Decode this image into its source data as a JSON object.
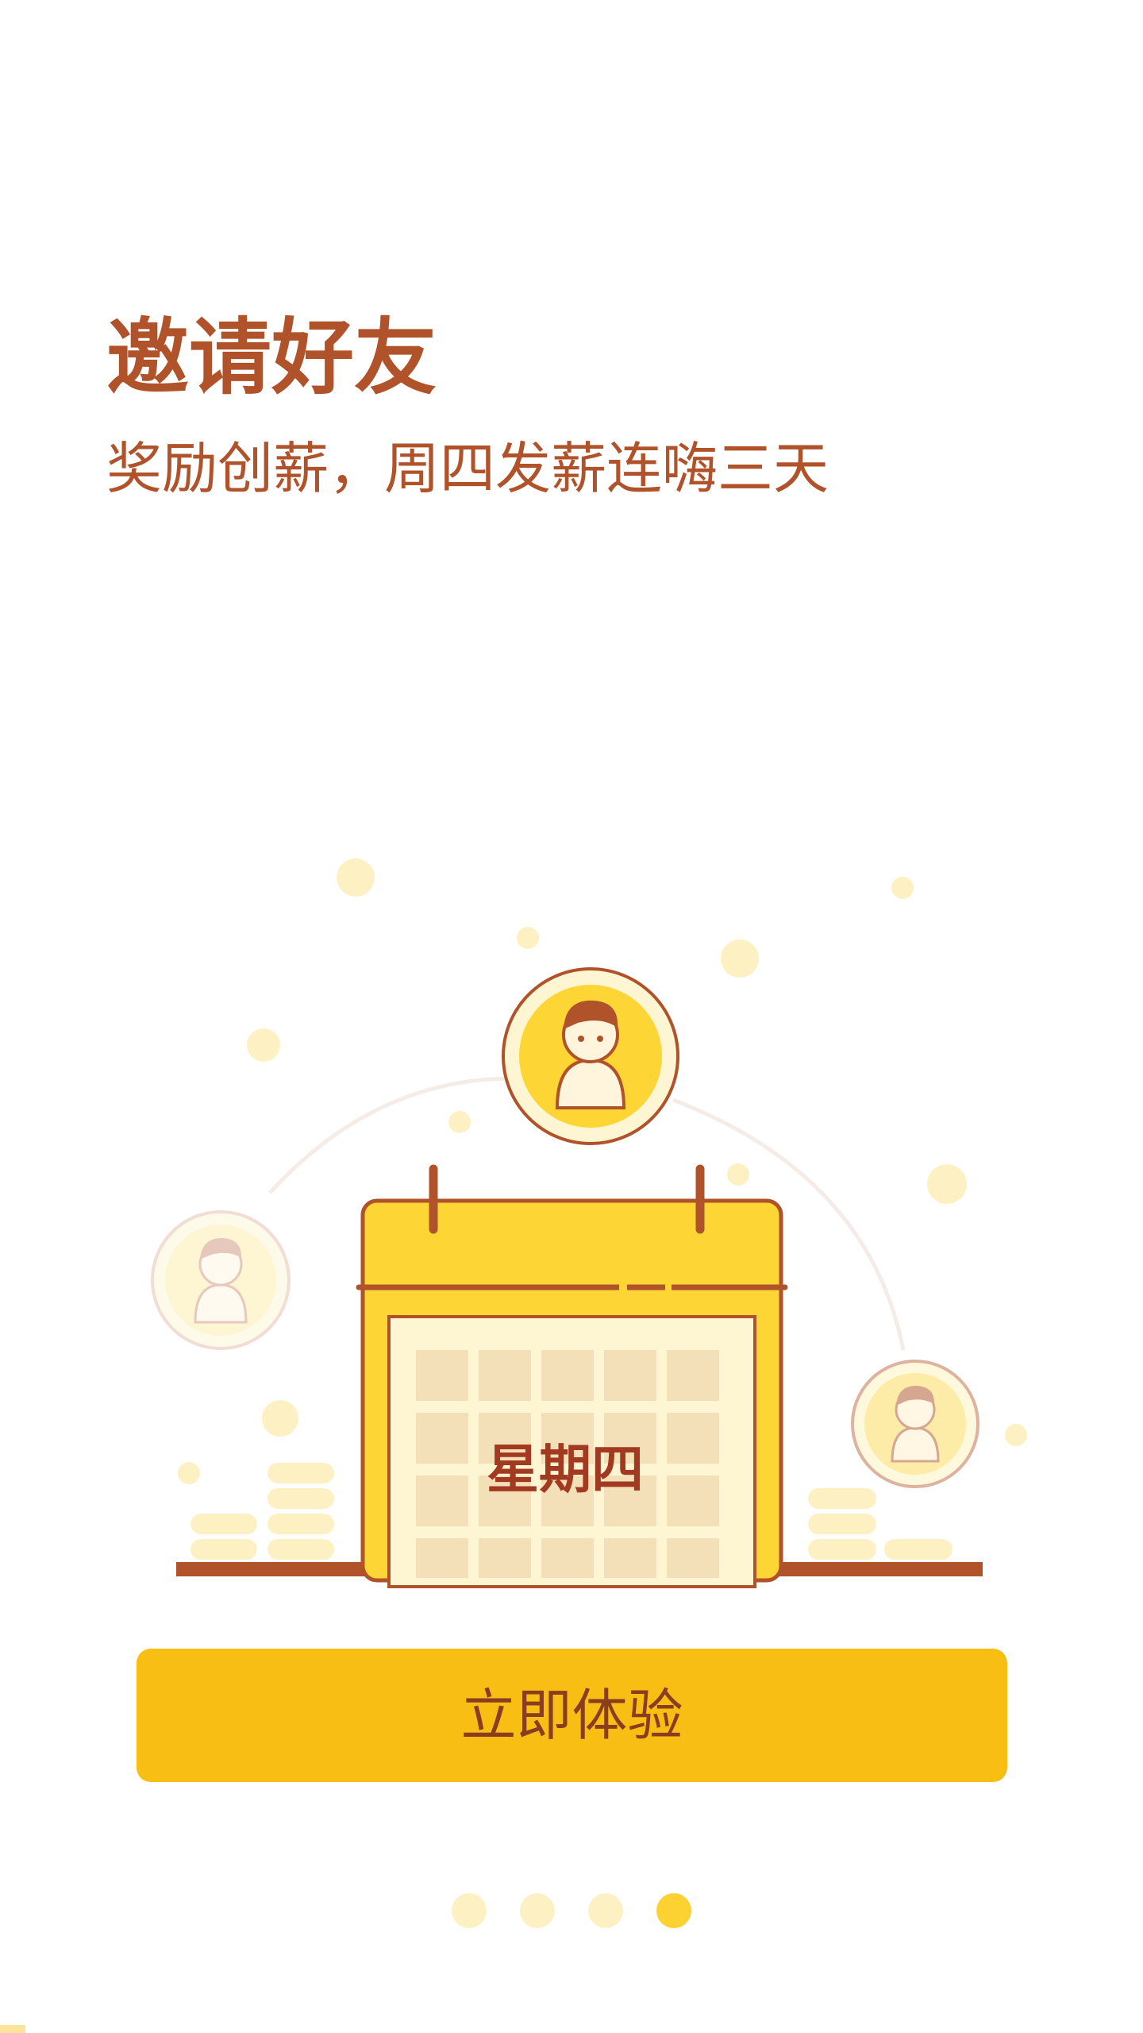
{
  "onboarding": {
    "title": "邀请好友",
    "subtitle": "奖励创薪，周四发薪连嗨三天",
    "illustration": {
      "calendar_day": "星期四",
      "icons": [
        "calendar-icon",
        "user-avatar-icon",
        "coin-stack-icon"
      ]
    },
    "cta_label": "立即体验",
    "pager": {
      "total": 4,
      "current": 4
    }
  },
  "colors": {
    "accent": "#f8be14",
    "text": "#b0532b",
    "dot_inactive": "#fdf1c4",
    "dot_active": "#fbd232"
  }
}
